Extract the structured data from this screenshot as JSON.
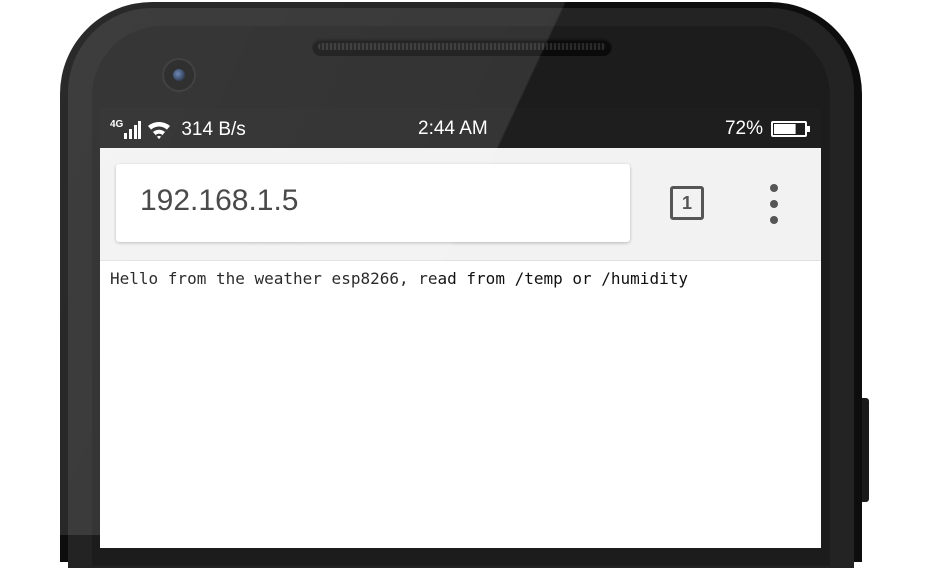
{
  "status_bar": {
    "network_type": "4G",
    "data_speed": "314 B/s",
    "time": "2:44 AM",
    "battery_percent": "72%",
    "battery_level": 0.72
  },
  "browser": {
    "url": "192.168.1.5",
    "tab_count": "1"
  },
  "page": {
    "body_text": "Hello from the weather esp8266, read from /temp or /humidity"
  },
  "icons": {
    "signal": "signal-icon",
    "wifi": "wifi-icon",
    "battery": "battery-icon",
    "tabs": "tab-switcher-icon",
    "menu": "more-vert-icon"
  }
}
